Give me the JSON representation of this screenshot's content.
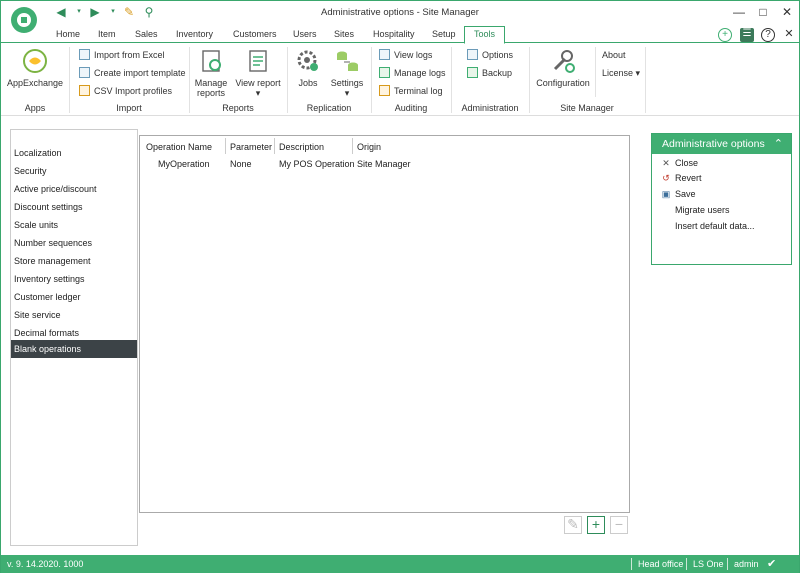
{
  "window": {
    "title": "Administrative options - Site Manager"
  },
  "ribbon_tabs": [
    "Home",
    "Item",
    "Sales",
    "Inventory",
    "Customers",
    "Users",
    "Sites",
    "Hospitality",
    "Setup",
    "Tools"
  ],
  "active_tab": "Tools",
  "ribbon": {
    "apps": {
      "label": "Apps",
      "appexchange": "AppExchange"
    },
    "import": {
      "label": "Import",
      "excel": "Import from Excel",
      "template": "Create import template",
      "csv": "CSV Import profiles"
    },
    "reports": {
      "label": "Reports",
      "manage_1": "Manage",
      "manage_2": "reports",
      "view": "View report"
    },
    "replication": {
      "label": "Replication",
      "jobs": "Jobs",
      "settings": "Settings"
    },
    "auditing": {
      "label": "Auditing",
      "view_logs": "View logs",
      "manage_logs": "Manage logs",
      "terminal_log": "Terminal log"
    },
    "administration": {
      "label": "Administration",
      "options": "Options",
      "backup": "Backup"
    },
    "site_manager": {
      "label": "Site Manager",
      "configuration": "Configuration",
      "about": "About",
      "license": "License"
    }
  },
  "nav": {
    "items": [
      "Localization",
      "Security",
      "Active price/discount",
      "Discount settings",
      "Scale units",
      "Number sequences",
      "Store management",
      "Inventory settings",
      "Customer ledger",
      "Site service",
      "Decimal formats",
      "Blank operations"
    ],
    "selected": "Blank operations"
  },
  "grid": {
    "columns": [
      "Operation Name",
      "Parameter",
      "Description",
      "Origin"
    ],
    "rows": [
      [
        "MyOperation",
        "None",
        "My POS Operation",
        "Site Manager"
      ]
    ]
  },
  "admin_panel": {
    "title": "Administrative options",
    "items": [
      "Close",
      "Revert",
      "Save",
      "Migrate users",
      "Insert default data..."
    ]
  },
  "status_bar": {
    "version": "v. 9. 14.2020. 1000",
    "location": "Head office",
    "product": "LS One",
    "user": "admin"
  },
  "colors": {
    "accent": "#3fae72",
    "selected_nav": "#3c4347"
  }
}
